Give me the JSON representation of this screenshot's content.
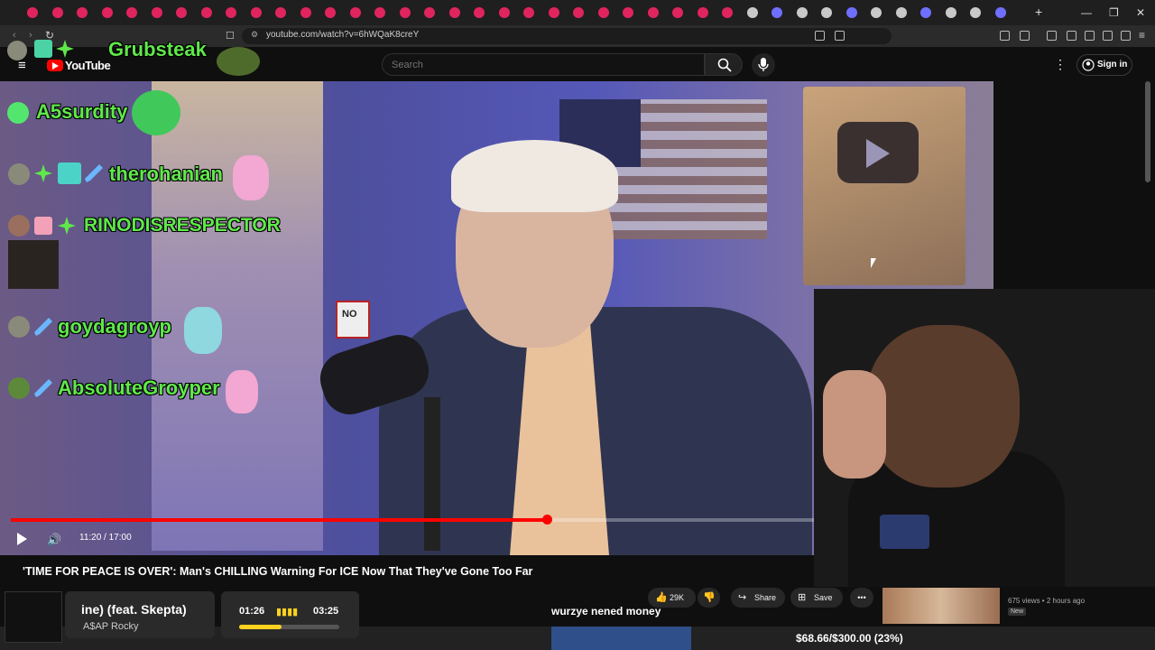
{
  "browser": {
    "url": "youtube.com/watch?v=6hWQaK8creY",
    "new_tab": "+",
    "window_controls": [
      "—",
      "❐",
      "✕"
    ]
  },
  "youtube": {
    "logo_text": "YouTube",
    "search_placeholder": "Search",
    "signin_label": "Sign in"
  },
  "player": {
    "time_display": "11:20 / 17:00",
    "progress_fraction": 0.667
  },
  "video": {
    "title": "'TIME FOR PEACE IS OVER': Man's CHILLING Warning For ICE Now That They've Gone Too Far",
    "likes_label": "29K",
    "share_label": "Share",
    "save_label": "Save",
    "sign_text": "NO"
  },
  "chat": [
    {
      "name": "Grubsteak"
    },
    {
      "name": "A5surdity"
    },
    {
      "name": "therohanian"
    },
    {
      "name": "RINODISRESPECTOR"
    },
    {
      "name": "goydagroyp"
    },
    {
      "name": "AbsoluteGroyper"
    }
  ],
  "now_playing": {
    "title": "ine) (feat. Skepta)",
    "artist": "A$AP Rocky",
    "elapsed": "01:26",
    "total": "03:25",
    "progress_fraction": 0.42
  },
  "overlay": {
    "subtitle_text": "wurzye nened money",
    "donation_text": "$68.66/$300.00 (23%)"
  },
  "recommendation": {
    "views": "675 views • 2 hours ago",
    "badge": "New"
  },
  "colors": {
    "youtube_red": "#ff0000",
    "chat_green": "#5fe84a",
    "song_bar_yellow": "#ffd21f"
  }
}
